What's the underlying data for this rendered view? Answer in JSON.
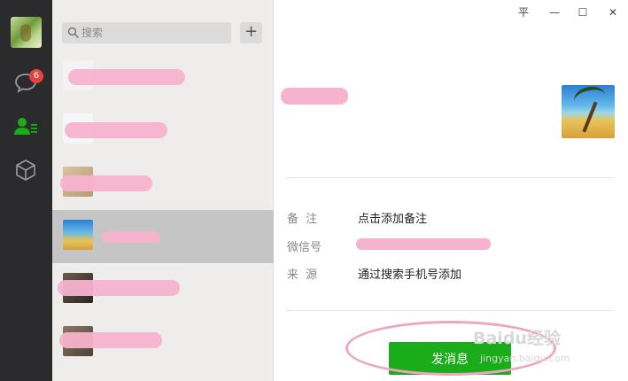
{
  "sidebar": {
    "badge_count": "6",
    "icons": [
      "avatar",
      "chat-icon",
      "contacts-icon",
      "box-icon"
    ]
  },
  "search": {
    "placeholder": "搜索",
    "add_label": "+"
  },
  "window_controls": {
    "pin": "平",
    "minimize": "—",
    "maximize": "☐",
    "close": "✕"
  },
  "profile": {
    "remark_label": "备 注",
    "remark_value": "点击添加备注",
    "wechat_id_label": "微信号",
    "source_label": "来 源",
    "source_value": "通过搜索手机号添加",
    "send_button": "发消息"
  },
  "watermark": {
    "brand": "Baidu经验",
    "url": "jingyan.baidu.com"
  },
  "colors": {
    "accent": "#1aad19",
    "badge": "#e64340",
    "redaction": "#f7b3cd"
  }
}
